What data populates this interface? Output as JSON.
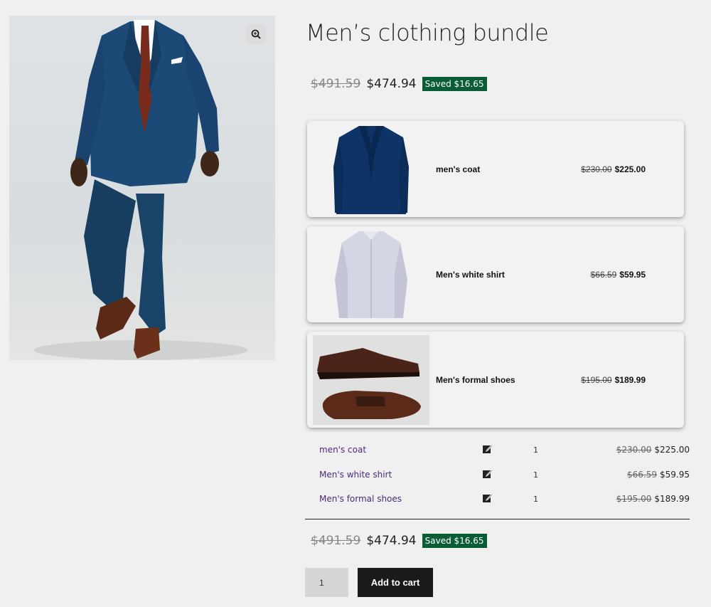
{
  "product": {
    "title": "Men’s clothing bundle",
    "price_old": "$491.59",
    "price_new": "$474.94",
    "saved": "Saved $16.65"
  },
  "bundle_items": [
    {
      "name": "men's coat",
      "old": "$230.00",
      "new": "$225.00",
      "icon": "coat-image"
    },
    {
      "name": "Men's white shirt",
      "old": "$66.59",
      "new": "$59.95",
      "icon": "shirt-image"
    },
    {
      "name": "Men's formal shoes",
      "old": "$195.00",
      "new": "$189.99",
      "icon": "shoes-image"
    }
  ],
  "summary": [
    {
      "name": "men's coat",
      "qty": "1",
      "old": "$230.00",
      "new": "$225.00"
    },
    {
      "name": "Men's white shirt",
      "qty": "1",
      "old": "$66.59",
      "new": "$59.95"
    },
    {
      "name": "Men's formal shoes",
      "qty": "1",
      "old": "$195.00",
      "new": "$189.99"
    }
  ],
  "total": {
    "price_old": "$491.59",
    "price_new": "$474.94",
    "saved": "Saved $16.65"
  },
  "cart": {
    "quantity": "1",
    "button_label": "Add to cart"
  },
  "colors": {
    "badge": "#0a5c36",
    "link": "#4b2a7a",
    "button": "#1a1a1a"
  }
}
